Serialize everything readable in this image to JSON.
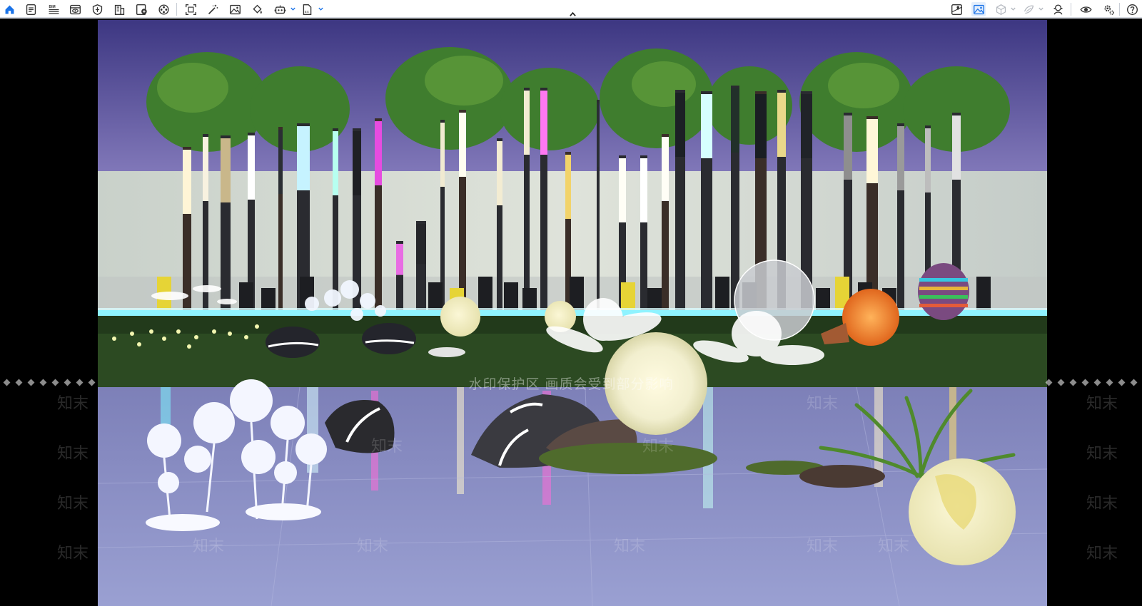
{
  "toolbar": {
    "left_icons": [
      "home-icon",
      "document-list-icon",
      "bim-icon",
      "view-panel-icon",
      "shield-icon",
      "building-icon",
      "image-badge-icon",
      "film-reel-icon",
      "scan-frame-icon",
      "magic-wand-icon",
      "picture-icon",
      "paint-bucket-icon",
      "robot-icon",
      "export-file-icon"
    ],
    "bim_label": "BIM",
    "right_icons": [
      "map-pin-icon",
      "gallery-icon",
      "cube-icon",
      "layers-icon",
      "pen-tool-icon",
      "eye-icon",
      "settings-icon",
      "help-icon"
    ],
    "accent_color": "#1a73e8"
  },
  "watermark": {
    "banner": "水印保护区   画质会受到部分影响",
    "tile": "知末"
  },
  "colors": {
    "sky_top": "#3f3a86",
    "sky_bottom": "#7a72b8",
    "wall": "#d6dbd3",
    "lawn": "#2f4a22",
    "water": "#8a8fc4",
    "glow_yellow": "#fff6c2"
  }
}
